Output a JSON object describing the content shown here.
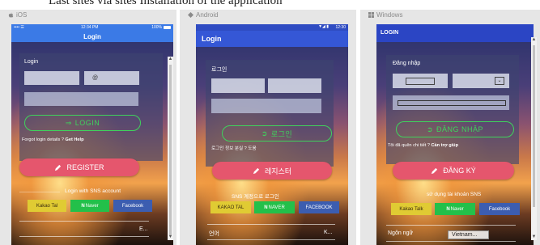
{
  "caption": "Last sites via sites Installation of the application",
  "platforms": {
    "ios": {
      "label": "iOS",
      "carrier": "•••• ☰",
      "time": "12:34 PM",
      "battery": "100%",
      "title": "Login",
      "card_label": "Login",
      "email_at": "@",
      "login_button": "LOGIN",
      "forgot_prefix": "Forgot login details ? ",
      "forgot_link": "Get Help",
      "register_button": "REGISTER",
      "sns_text": "Login with SNS account",
      "kakao": "Kakao Tal",
      "naver": "Naver",
      "facebook": "Facebook",
      "language_value": "E..."
    },
    "android": {
      "label": "Android",
      "time": "12:30",
      "title": "Login",
      "card_label": "로그인",
      "login_button": "로그인",
      "forgot_text": "로그인 정보 분실 ? 도움",
      "register_button": "레지스터",
      "sns_text": "SNS 계정으로 로그인",
      "kakao": "KAKAO TAL",
      "naver": "NAVER",
      "facebook": "FACEBOOK",
      "language_label": "언어",
      "language_value": "K..."
    },
    "windows": {
      "label": "Windows",
      "title": "LOGIN",
      "card_label": "Đăng nhập",
      "login_button": "ĐĂNG NHẬP",
      "forgot_prefix": "Tôi đã quên chi tiết ? ",
      "forgot_link": "Cần trợ giúp",
      "register_button": "ĐĂNG KÝ",
      "sns_text": "sử dụng tài khoản SNS",
      "kakao": "Kakao Talk",
      "naver": "Naver",
      "facebook": "Facebook",
      "language_label": "Ngôn ngữ",
      "language_value": "Vietnam..."
    }
  },
  "colors": {
    "ios_bar": "#3b7ae6",
    "register": "#e5566d",
    "login_outline": "#3fd35c",
    "kakao": "#e0cb33",
    "naver": "#23c04a",
    "facebook": "#3c5db0"
  }
}
